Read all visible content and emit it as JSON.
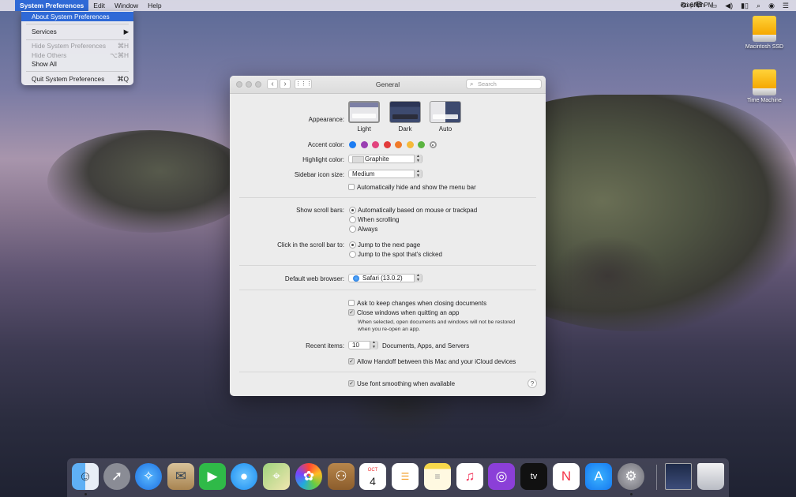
{
  "menubar": {
    "apple": "",
    "app_name": "System Preferences",
    "menus": [
      "Edit",
      "Window",
      "Help"
    ],
    "clock": "Fri 6:41 PM",
    "user": "Stephen"
  },
  "app_menu": {
    "about": "About System Preferences",
    "services": "Services",
    "services_arrow": "▶",
    "hide": "Hide System Preferences",
    "hide_sc": "⌘H",
    "hide_others": "Hide Others",
    "hide_others_sc": "⌥⌘H",
    "show_all": "Show All",
    "quit": "Quit System Preferences",
    "quit_sc": "⌘Q"
  },
  "desktop_icons": {
    "disk": "Macintosh SSD",
    "time_machine": "Time Machine"
  },
  "window": {
    "title": "General",
    "search_placeholder": "Search",
    "appearance_label": "Appearance:",
    "appearance_options": [
      "Light",
      "Dark",
      "Auto"
    ],
    "accent_label": "Accent color:",
    "accent_colors": [
      "#1c7cf2",
      "#9a3fb2",
      "#e2447e",
      "#e23b3b",
      "#f07a2a",
      "#f5b93a",
      "#5bb441",
      "#9b9b9b"
    ],
    "highlight_label": "Highlight color:",
    "highlight_value": "Graphite",
    "sidebar_label": "Sidebar icon size:",
    "sidebar_value": "Medium",
    "menubar_hide": "Automatically hide and show the menu bar",
    "scroll_label": "Show scroll bars:",
    "scroll_options": [
      "Automatically based on mouse or trackpad",
      "When scrolling",
      "Always"
    ],
    "click_label": "Click in the scroll bar to:",
    "click_options": [
      "Jump to the next page",
      "Jump to the spot that's clicked"
    ],
    "browser_label": "Default web browser:",
    "browser_value": "Safari (13.0.2)",
    "ask_keep": "Ask to keep changes when closing documents",
    "close_windows": "Close windows when quitting an app",
    "close_note_1": "When selected, open documents and windows will not be restored",
    "close_note_2": "when you re-open an app.",
    "recent_label": "Recent items:",
    "recent_value": "10",
    "recent_suffix": "Documents, Apps, and Servers",
    "handoff": "Allow Handoff between this Mac and your iCloud devices",
    "font_smoothing": "Use font smoothing when available",
    "help": "?"
  },
  "dock": {
    "calendar_month": "OCT",
    "calendar_day": "4",
    "tv_label": "tv"
  }
}
